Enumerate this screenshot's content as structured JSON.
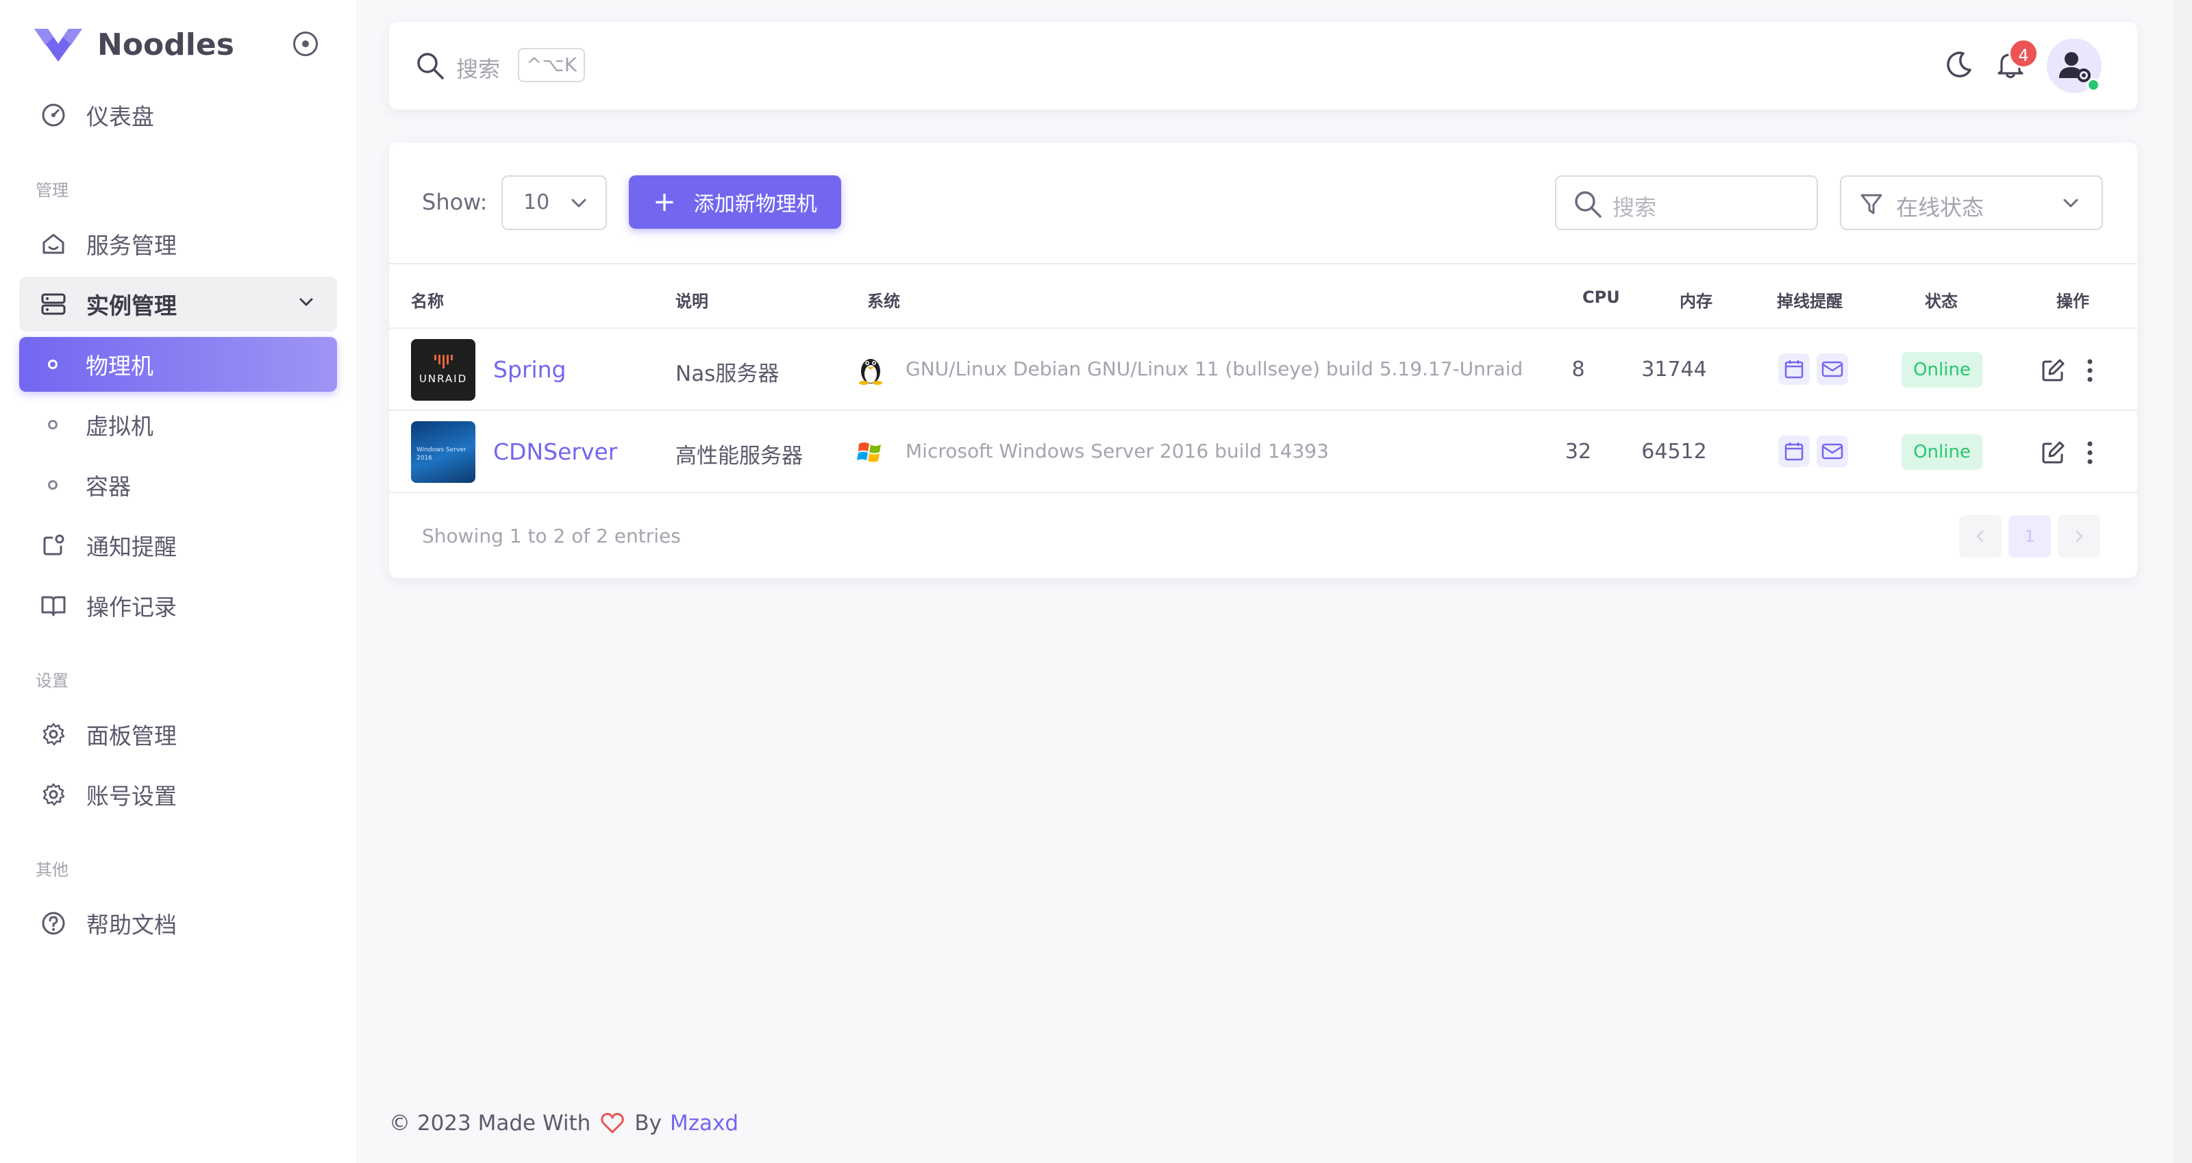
{
  "brand": {
    "name": "Noodles"
  },
  "sidebar": {
    "dashboard": "仪表盘",
    "section_manage": "管理",
    "service_mgmt": "服务管理",
    "instance_mgmt": "实例管理",
    "sub_items": [
      "物理机",
      "虚拟机",
      "容器"
    ],
    "notify": "通知提醒",
    "oplog": "操作记录",
    "section_settings": "设置",
    "panel_mgmt": "面板管理",
    "account_settings": "账号设置",
    "section_other": "其他",
    "help_docs": "帮助文档"
  },
  "navbar": {
    "search_placeholder": "搜索",
    "shortcut": "^⌥K",
    "notification_count": "4"
  },
  "toolbar": {
    "show_label": "Show:",
    "page_size": "10",
    "add_button": "添加新物理机",
    "search_placeholder": "搜索",
    "status_filter": "在线状态"
  },
  "table": {
    "headers": {
      "name": "名称",
      "desc": "说明",
      "system": "系统",
      "cpu": "CPU",
      "memory": "内存",
      "offline_alert": "掉线提醒",
      "status": "状态",
      "actions": "操作"
    },
    "rows": [
      {
        "name": "Spring",
        "desc": "Nas服务器",
        "os_icon": "linux-icon",
        "system": "GNU/Linux Debian GNU/Linux 11 (bullseye) build 5.19.17-Unraid",
        "cpu": "8",
        "memory": "31744",
        "status": "Online",
        "thumb_word": "UNRAID"
      },
      {
        "name": "CDNServer",
        "desc": "高性能服务器",
        "os_icon": "windows-icon",
        "system": "Microsoft Windows Server 2016 build 14393",
        "cpu": "32",
        "memory": "64512",
        "status": "Online",
        "thumb_word": "Windows Server 2016"
      }
    ]
  },
  "pagination": {
    "info": "Showing 1 to 2 of 2 entries",
    "current_page": "1"
  },
  "footer": {
    "prefix": "© 2023 Made With",
    "by": "By",
    "author": "Mzaxd"
  },
  "colors": {
    "primary": "#7367f0",
    "success": "#28c76f",
    "danger": "#ea5455"
  }
}
